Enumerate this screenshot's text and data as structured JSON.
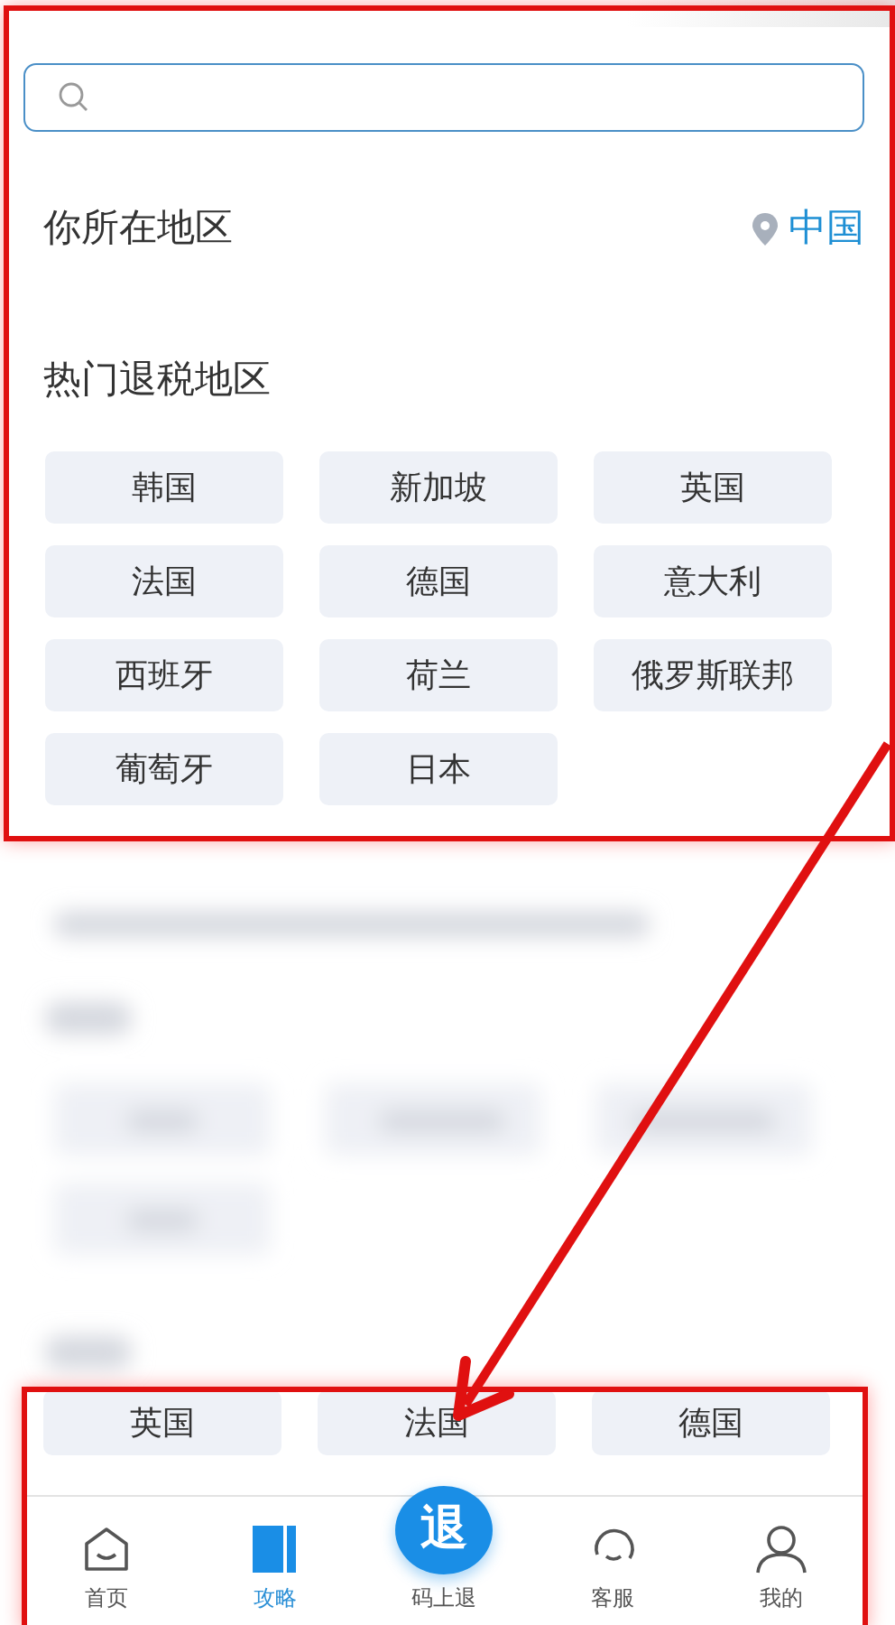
{
  "location": {
    "label": "你所在地区",
    "value": "中国"
  },
  "hot_regions": {
    "title": "热门退税地区",
    "items": [
      "韩国",
      "新加坡",
      "英国",
      "法国",
      "德国",
      "意大利",
      "西班牙",
      "荷兰",
      "俄罗斯联邦",
      "葡萄牙",
      "日本"
    ]
  },
  "lower_regions": [
    "英国",
    "法国",
    "德国"
  ],
  "tab_bar": [
    {
      "label": "首页",
      "kind": "home",
      "selected": false
    },
    {
      "label": "攻略",
      "kind": "guide",
      "selected": true
    },
    {
      "label": "码上退",
      "kind": "center",
      "badge": "退",
      "selected": false
    },
    {
      "label": "客服",
      "kind": "service",
      "selected": false
    },
    {
      "label": "我的",
      "kind": "profile",
      "selected": false
    }
  ],
  "annotations": [
    {
      "kind": "frame"
    },
    {
      "kind": "frame"
    },
    {
      "kind": "arrow"
    }
  ]
}
